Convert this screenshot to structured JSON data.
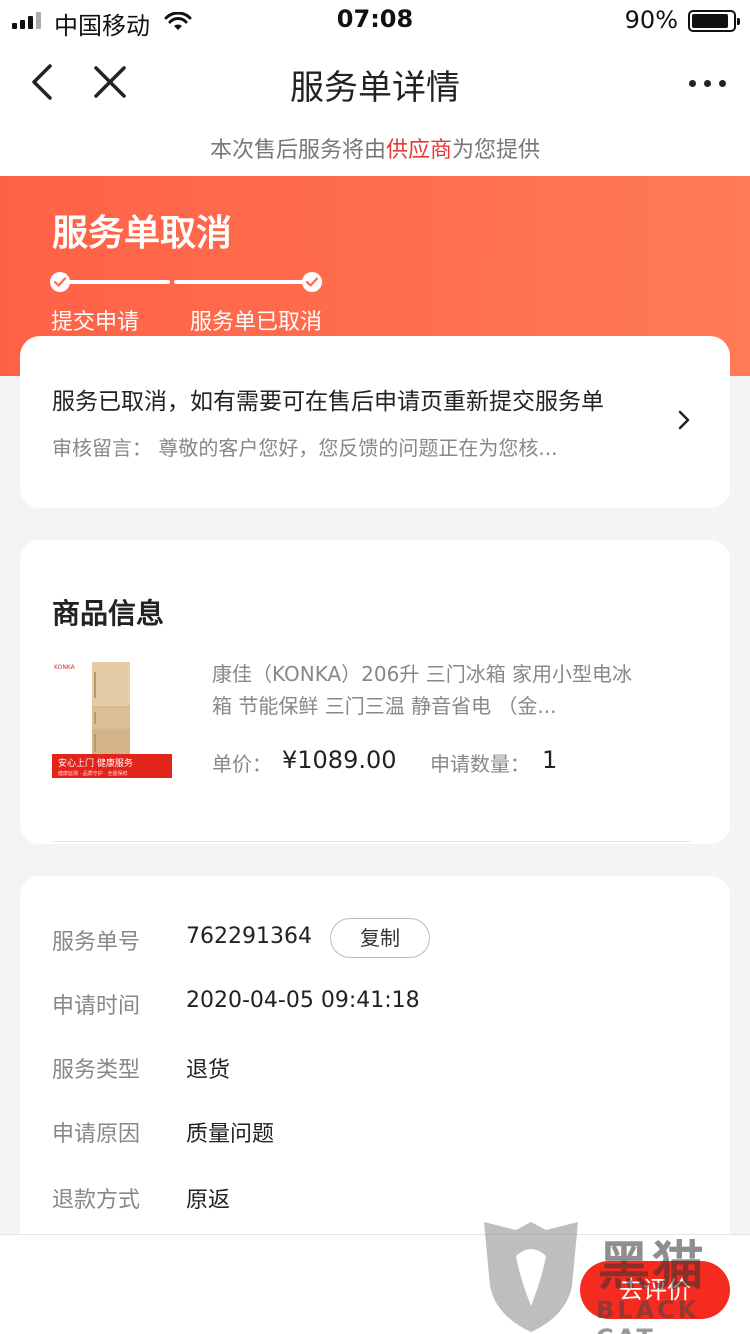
{
  "status_bar": {
    "carrier": "中国移动",
    "time": "07:08",
    "battery_percent": "90%",
    "battery_level": 0.9
  },
  "nav": {
    "title": "服务单详情"
  },
  "supplier_notice": {
    "prefix": "本次售后服务将由",
    "highlight": "供应商",
    "suffix": "为您提供"
  },
  "banner": {
    "title": "服务单取消",
    "steps": [
      {
        "label": "提交申请"
      },
      {
        "label": "服务单已取消"
      }
    ]
  },
  "status_card": {
    "message": "服务已取消，如有需要可在售后申请页重新提交服务单",
    "review_note": "审核留言：  尊敬的客户您好，您反馈的问题正在为您核..."
  },
  "goods": {
    "heading": "商品信息",
    "name": "康佳（KONKA）206升 三门冰箱 家用小型电冰箱 节能保鲜 三门三温 静音省电 （金...",
    "price_label": "单价：",
    "price": "¥1089.00",
    "qty_label": "申请数量：",
    "qty": "1",
    "thumb_brand": "KONKA",
    "thumb_banner": "安心上门 健康服务",
    "thumb_subtext": "健康监测 · 品质守护 · 全屋保鲜"
  },
  "details": [
    {
      "key": "服务单号",
      "value": "762291364"
    },
    {
      "key": "申请时间",
      "value": "2020-04-05 09:41:18"
    },
    {
      "key": "服务类型",
      "value": "退货"
    },
    {
      "key": "申请原因",
      "value": "质量问题"
    },
    {
      "key": "退款方式",
      "value": "原返"
    }
  ],
  "copy_label": "复制",
  "review_button": "去评价",
  "watermark": {
    "cn": "黑猫",
    "en": "BLACK CAT"
  },
  "colors": {
    "accent": "#f52b1f",
    "banner": "#ff6a4d",
    "highlight": "#e53935"
  }
}
